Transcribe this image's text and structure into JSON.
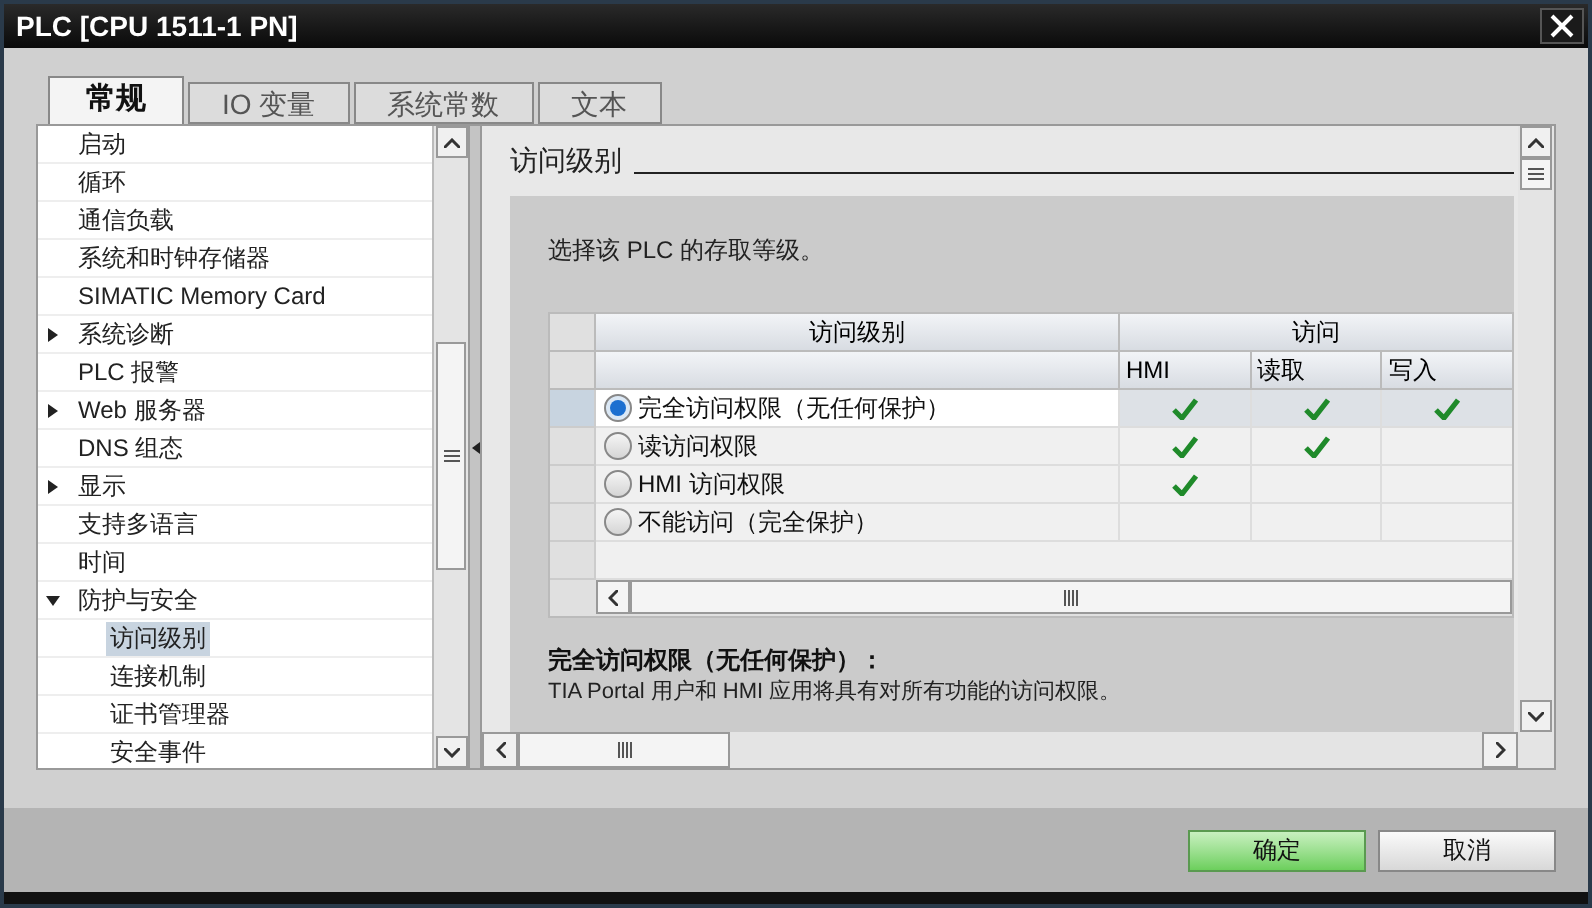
{
  "window": {
    "title": "PLC [CPU 1511-1 PN]"
  },
  "tabs": [
    {
      "label": "常规",
      "selected": true
    },
    {
      "label": "IO 变量",
      "selected": false
    },
    {
      "label": "系统常数",
      "selected": false
    },
    {
      "label": "文本",
      "selected": false
    }
  ],
  "nav": [
    {
      "label": "启动",
      "selected": false
    },
    {
      "label": "循环",
      "selected": false
    },
    {
      "label": "通信负载",
      "selected": false
    },
    {
      "label": "系统和时钟存储器",
      "selected": false
    },
    {
      "label": "SIMATIC Memory Card",
      "selected": false
    },
    {
      "label": "系统诊断",
      "selected": false,
      "expanded": false
    },
    {
      "label": "PLC 报警",
      "selected": false
    },
    {
      "label": "Web 服务器",
      "selected": false,
      "expanded": false
    },
    {
      "label": "DNS 组态",
      "selected": false
    },
    {
      "label": "显示",
      "selected": false,
      "expanded": false
    },
    {
      "label": "支持多语言",
      "selected": false
    },
    {
      "label": "时间",
      "selected": false
    },
    {
      "label": "防护与安全",
      "selected": false,
      "expanded": true,
      "children": [
        {
          "label": "访问级别",
          "selected": true
        },
        {
          "label": "连接机制",
          "selected": false
        },
        {
          "label": "证书管理器",
          "selected": false
        },
        {
          "label": "安全事件",
          "selected": false
        }
      ]
    }
  ],
  "section": {
    "title": "访问级别",
    "instruction": "选择该 PLC 的存取等级。"
  },
  "table": {
    "columns": {
      "level": "访问级别",
      "access": "访问",
      "access_columns": [
        "HMI",
        "读取",
        "写入"
      ]
    },
    "rows": [
      {
        "label": "完全访问权限（无任何保护）",
        "selected": true,
        "access": [
          true,
          true,
          true
        ]
      },
      {
        "label": "读访问权限",
        "selected": false,
        "access": [
          true,
          true,
          false
        ]
      },
      {
        "label": "HMI 访问权限",
        "selected": false,
        "access": [
          true,
          false,
          false
        ]
      },
      {
        "label": "不能访问（完全保护）",
        "selected": false,
        "access": [
          false,
          false,
          false
        ]
      }
    ]
  },
  "description": {
    "title": "完全访问权限（无任何保护）：",
    "text": "TIA Portal 用户和 HMI 应用将具有对所有功能的访问权限。"
  },
  "buttons": [
    {
      "label": "确定",
      "kind": "primary"
    },
    {
      "label": "取消",
      "kind": "default"
    }
  ]
}
